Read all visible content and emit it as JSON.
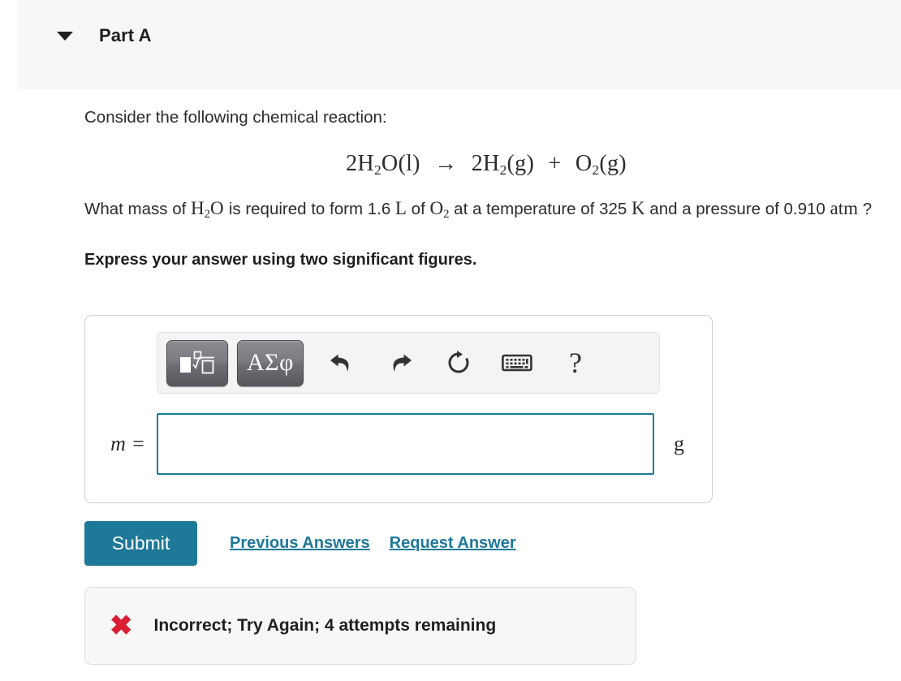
{
  "part": {
    "title": "Part A",
    "caret_icon": "caret-down-icon",
    "expanded": true
  },
  "question": {
    "intro": "Consider the following chemical reaction:",
    "equation": {
      "reactant_coeff": "2",
      "reactant": "H",
      "reactant_sub": "2",
      "reactant_tail": "O(l)",
      "arrow": "→",
      "product1_coeff": "2",
      "product1": "H",
      "product1_sub": "2",
      "product1_state": "(g)",
      "plus": "+",
      "product2": "O",
      "product2_sub": "2",
      "product2_state": "(g)",
      "plain_text": "2H2O(l) → 2H2(g) + O2(g)"
    },
    "prompt_part1": "What mass of ",
    "prompt_species": "H",
    "prompt_species_sub": "2",
    "prompt_species_tail": "O",
    "prompt_part2": " is required to form 1.6 ",
    "prompt_volume_unit": "L",
    "prompt_part3": " of ",
    "prompt_gas": "O",
    "prompt_gas_sub": "2",
    "prompt_part4": " at a temperature of 325 ",
    "prompt_temp_unit": "K",
    "prompt_part5": " and a pressure of 0.910 ",
    "prompt_pressure_unit": "atm",
    "prompt_part6": " ?",
    "instruction": "Express your answer using two significant figures."
  },
  "toolbar": {
    "template_button": {
      "name": "math-template-button",
      "label": "math templates"
    },
    "greek_button": {
      "name": "greek-letters-button",
      "label": "ΑΣφ"
    },
    "undo": "undo-icon",
    "redo": "redo-icon",
    "reset": "reset-icon",
    "keyboard": "keyboard-icon",
    "help": "?"
  },
  "answer": {
    "variable": "m =",
    "value": "",
    "placeholder": "",
    "unit": "g"
  },
  "actions": {
    "submit_label": "Submit",
    "previous_answers_label": "Previous Answers",
    "request_answer_label": "Request Answer"
  },
  "feedback": {
    "icon": "x-mark-icon",
    "symbol": "✖",
    "message": "Incorrect; Try Again; 4 attempts remaining"
  },
  "colors": {
    "accent": "#1e7898",
    "error": "#d81f35",
    "header_bg": "#f7f7f7",
    "input_border": "#1c7b9c"
  }
}
